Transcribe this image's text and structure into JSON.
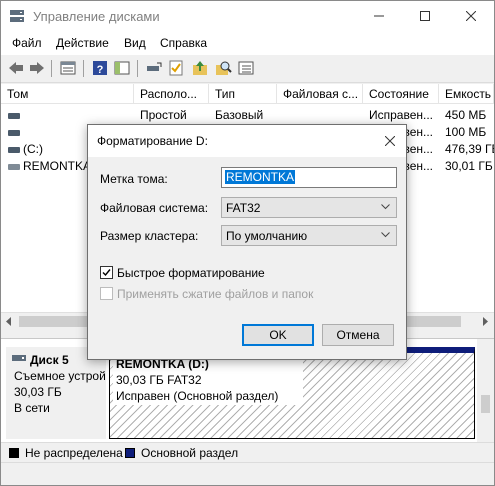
{
  "window": {
    "title": "Управление дисками"
  },
  "menu": [
    {
      "label": "Файл"
    },
    {
      "label": "Действие"
    },
    {
      "label": "Вид"
    },
    {
      "label": "Справка"
    }
  ],
  "columns": [
    "Том",
    "Располо...",
    "Тип",
    "Файловая с...",
    "Состояние",
    "Емкость"
  ],
  "volumes": [
    {
      "name": "",
      "layout": "Простой",
      "type": "Базовый",
      "fs": "",
      "status": "Исправен...",
      "capacity": "450 МБ"
    },
    {
      "name": "",
      "layout": "",
      "type": "",
      "fs": "",
      "status": "Исправен...",
      "capacity": "100 МБ"
    },
    {
      "name": "(C:)",
      "layout": "",
      "type": "",
      "fs": "",
      "status": "Исправен...",
      "capacity": "476,39 ГБ"
    },
    {
      "name": "REMONTKA",
      "layout": "",
      "type": "",
      "fs": "",
      "status": "Исправен...",
      "capacity": "30,01 ГБ"
    }
  ],
  "disk": {
    "name": "Диск 5",
    "kind": "Съемное устрой",
    "size": "30,03 ГБ",
    "state": "В сети",
    "partition": {
      "name": "REMONTKA (D:)",
      "info": "30,03 ГБ FAT32",
      "status": "Исправен (Основной раздел)"
    }
  },
  "legend": [
    {
      "label": "Не распределена",
      "color": "#000000"
    },
    {
      "label": "Основной раздел",
      "color": "#0e1d7a"
    }
  ],
  "dialog": {
    "title": "Форматирование D:",
    "volume_label_caption": "Метка тома:",
    "volume_label_value": "REMONTKA",
    "fs_caption": "Файловая система:",
    "fs_value": "FAT32",
    "cluster_caption": "Размер кластера:",
    "cluster_value": "По умолчанию",
    "quick_format": {
      "label": "Быстрое форматирование",
      "checked": true
    },
    "compression": {
      "label": "Применять сжатие файлов и папок",
      "checked": false,
      "disabled": true
    },
    "ok_label": "OK",
    "cancel_label": "Отмена"
  },
  "colors": {
    "accent": "#0078d7",
    "primary_partition": "#0e1d7a"
  }
}
